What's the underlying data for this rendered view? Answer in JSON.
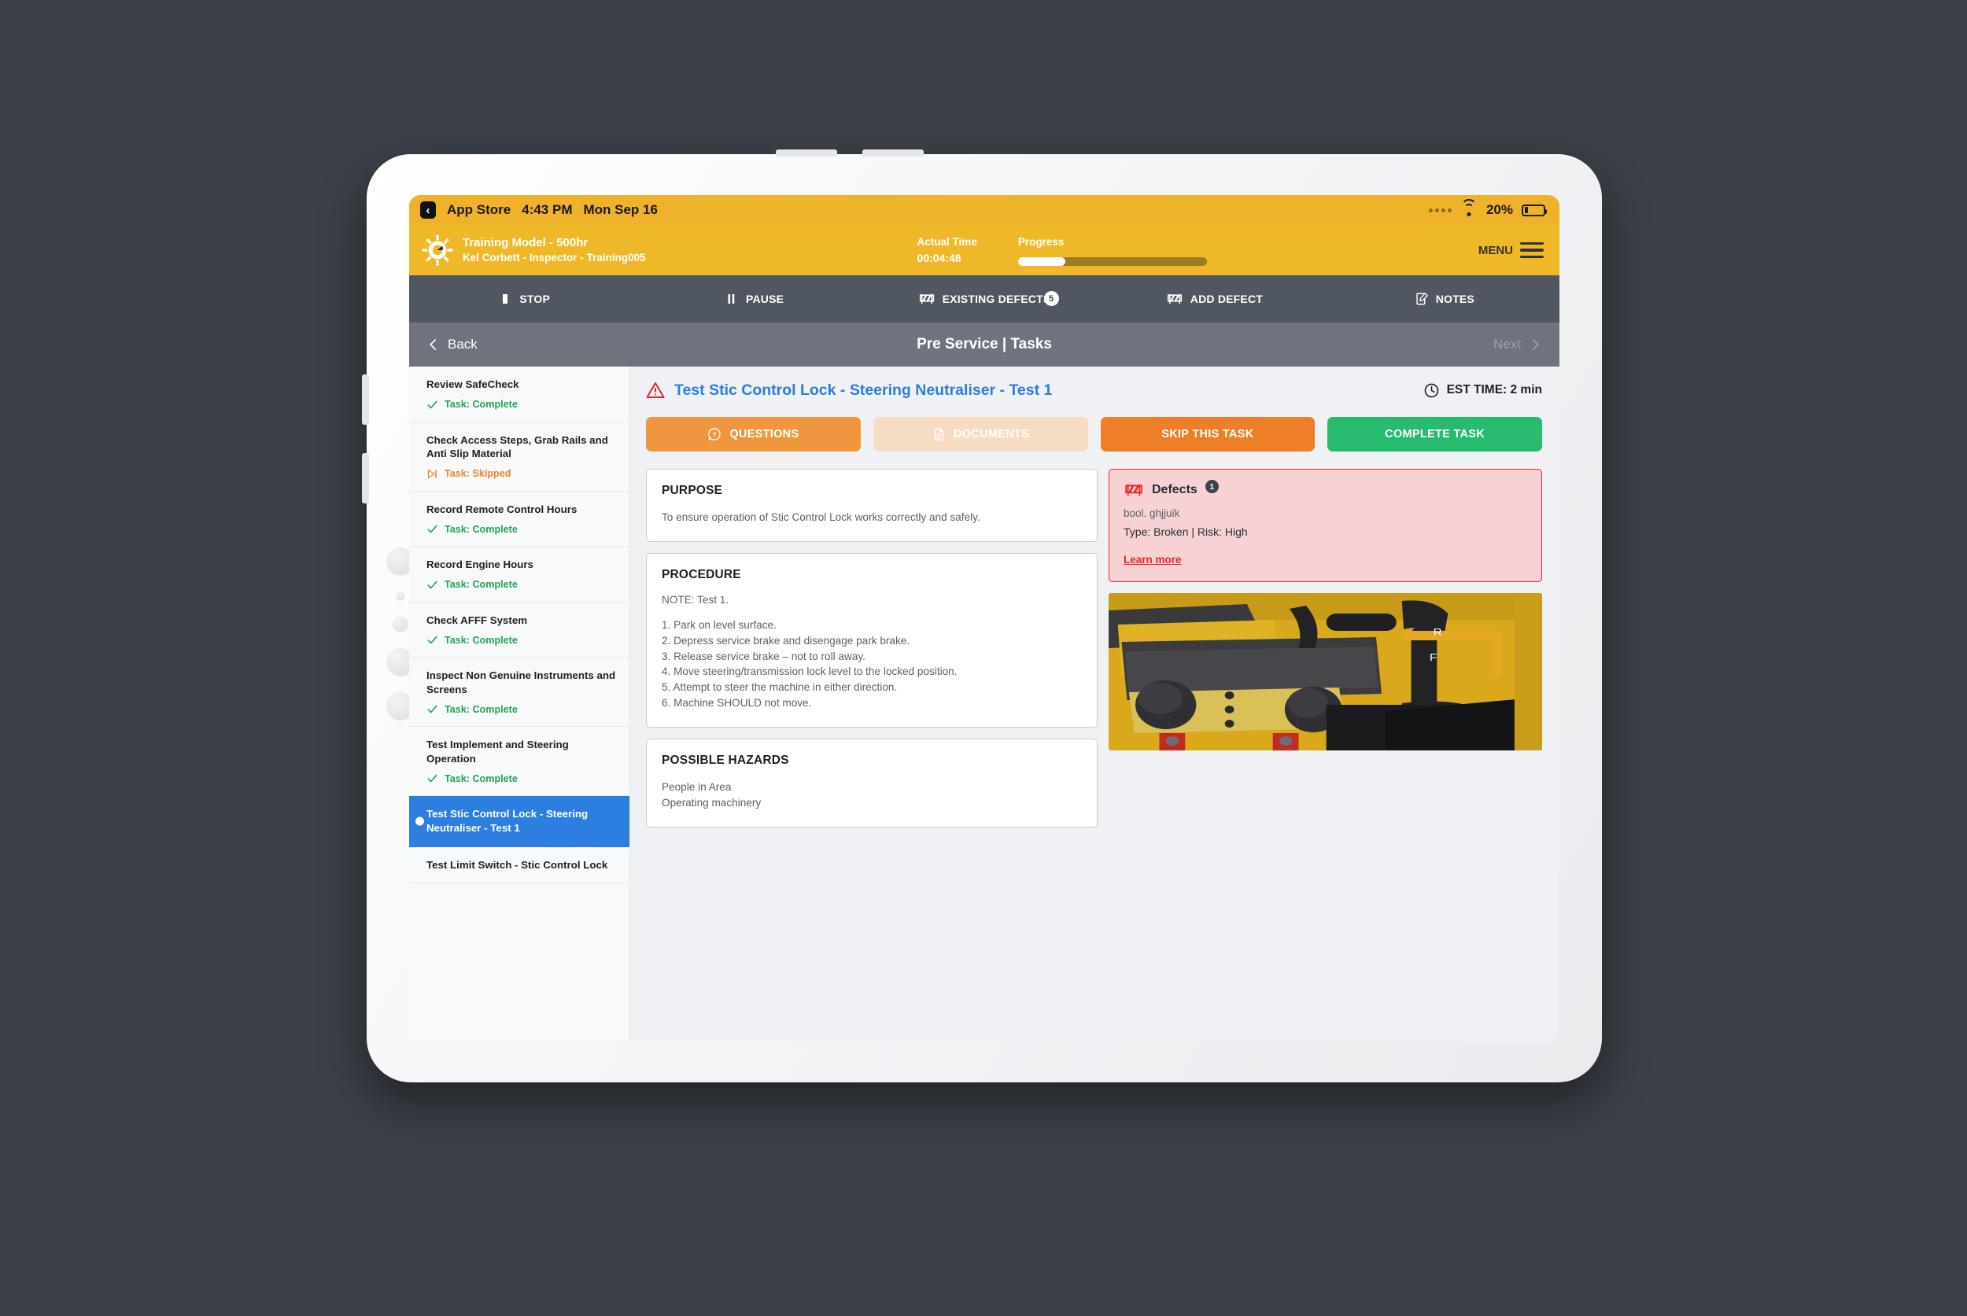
{
  "status_bar": {
    "back_app": "App Store",
    "back_icon": "chevron-left-icon",
    "time": "4:43 PM",
    "date": "Mon Sep 16",
    "signal_icon": "signal-dots-icon",
    "wifi_icon": "wifi-icon",
    "battery_label": "20%",
    "battery_icon": "battery-icon",
    "battery_percent": 20
  },
  "header": {
    "logo_icon": "gear-sun-logo-icon",
    "model": "Training Model - 500hr",
    "user": "Kel Corbett - Inspector - Training005",
    "actual_time_label": "Actual Time",
    "actual_time_value": "00:04:48",
    "progress_label": "Progress",
    "progress_percent": 25,
    "menu_label": "MENU",
    "menu_icon": "hamburger-menu-icon",
    "background_color": "#efb829"
  },
  "toolbar": {
    "items": [
      {
        "label": "STOP",
        "icon": "stop-square-icon",
        "badge": ""
      },
      {
        "label": "PAUSE",
        "icon": "pause-bars-icon",
        "badge": ""
      },
      {
        "label": "EXISTING DEFECTS",
        "icon": "barrier-icon",
        "badge": "5"
      },
      {
        "label": "ADD DEFECT",
        "icon": "barrier-icon",
        "badge": ""
      },
      {
        "label": "NOTES",
        "icon": "note-edit-icon",
        "badge": ""
      }
    ]
  },
  "navbar": {
    "back_label": "Back",
    "back_icon": "chevron-left-icon",
    "title": "Pre Service | Tasks",
    "next_label": "Next",
    "next_icon": "chevron-right-icon"
  },
  "sidebar": {
    "tasks": [
      {
        "name": "Review SafeCheck",
        "status": "Task: Complete",
        "state": "complete",
        "icon": "check-icon",
        "selected": false
      },
      {
        "name": "Check Access Steps, Grab Rails and Anti Slip Material",
        "status": "Task: Skipped",
        "state": "skipped",
        "icon": "skip-forward-icon",
        "selected": false
      },
      {
        "name": "Record Remote Control Hours",
        "status": "Task: Complete",
        "state": "complete",
        "icon": "check-icon",
        "selected": false
      },
      {
        "name": "Record Engine Hours",
        "status": "Task: Complete",
        "state": "complete",
        "icon": "check-icon",
        "selected": false
      },
      {
        "name": "Check AFFF System",
        "status": "Task: Complete",
        "state": "complete",
        "icon": "check-icon",
        "selected": false
      },
      {
        "name": "Inspect Non Genuine Instruments and Screens",
        "status": "Task: Complete",
        "state": "complete",
        "icon": "check-icon",
        "selected": false
      },
      {
        "name": "Test Implement and Steering Operation",
        "status": "Task: Complete",
        "state": "complete",
        "icon": "check-icon",
        "selected": false
      },
      {
        "name": "Test Stic Control Lock - Steering Neutraliser - Test 1",
        "status": "",
        "state": "current",
        "icon": "",
        "selected": true
      },
      {
        "name": "Test Limit Switch - Stic Control Lock",
        "status": "",
        "state": "pending",
        "icon": "",
        "selected": false
      }
    ]
  },
  "main": {
    "warning_icon": "warning-triangle-icon",
    "title": "Test Stic Control Lock - Steering Neutraliser - Test 1",
    "est_time_icon": "clock-icon",
    "est_time": "EST TIME: 2 min",
    "buttons": [
      {
        "label": "QUESTIONS",
        "icon": "question-bubble-icon",
        "style": "questions"
      },
      {
        "label": "DOCUMENTS",
        "icon": "document-icon",
        "style": "documents"
      },
      {
        "label": "SKIP THIS TASK",
        "icon": "",
        "style": "skip"
      },
      {
        "label": "COMPLETE TASK",
        "icon": "",
        "style": "complete"
      }
    ],
    "purpose": {
      "heading": "PURPOSE",
      "text": "To ensure operation of Stic Control Lock works correctly and safely."
    },
    "procedure": {
      "heading": "PROCEDURE",
      "note": "NOTE: Test 1.",
      "steps": [
        "1. Park on level surface.",
        "2. Depress service brake and disengage park brake.",
        "3. Release service brake – not to roll away.",
        "4. Move steering/transmission lock level to the locked position.",
        "5. Attempt to steer the machine in either direction.",
        "6. Machine SHOULD not move."
      ]
    },
    "hazards": {
      "heading": "POSSIBLE HAZARDS",
      "items": [
        "People in Area",
        "Operating machinery"
      ]
    },
    "defects": {
      "icon": "barrier-icon",
      "heading": "Defects",
      "count": "1",
      "description": "bool. ghjjuik",
      "meta": "Type: Broken | Risk: High",
      "link_label": "Learn more",
      "accent_color": "#e8262f",
      "background_color": "#f6d2d4"
    },
    "photo": {
      "alt": "machinery-control-levers-photo"
    }
  }
}
